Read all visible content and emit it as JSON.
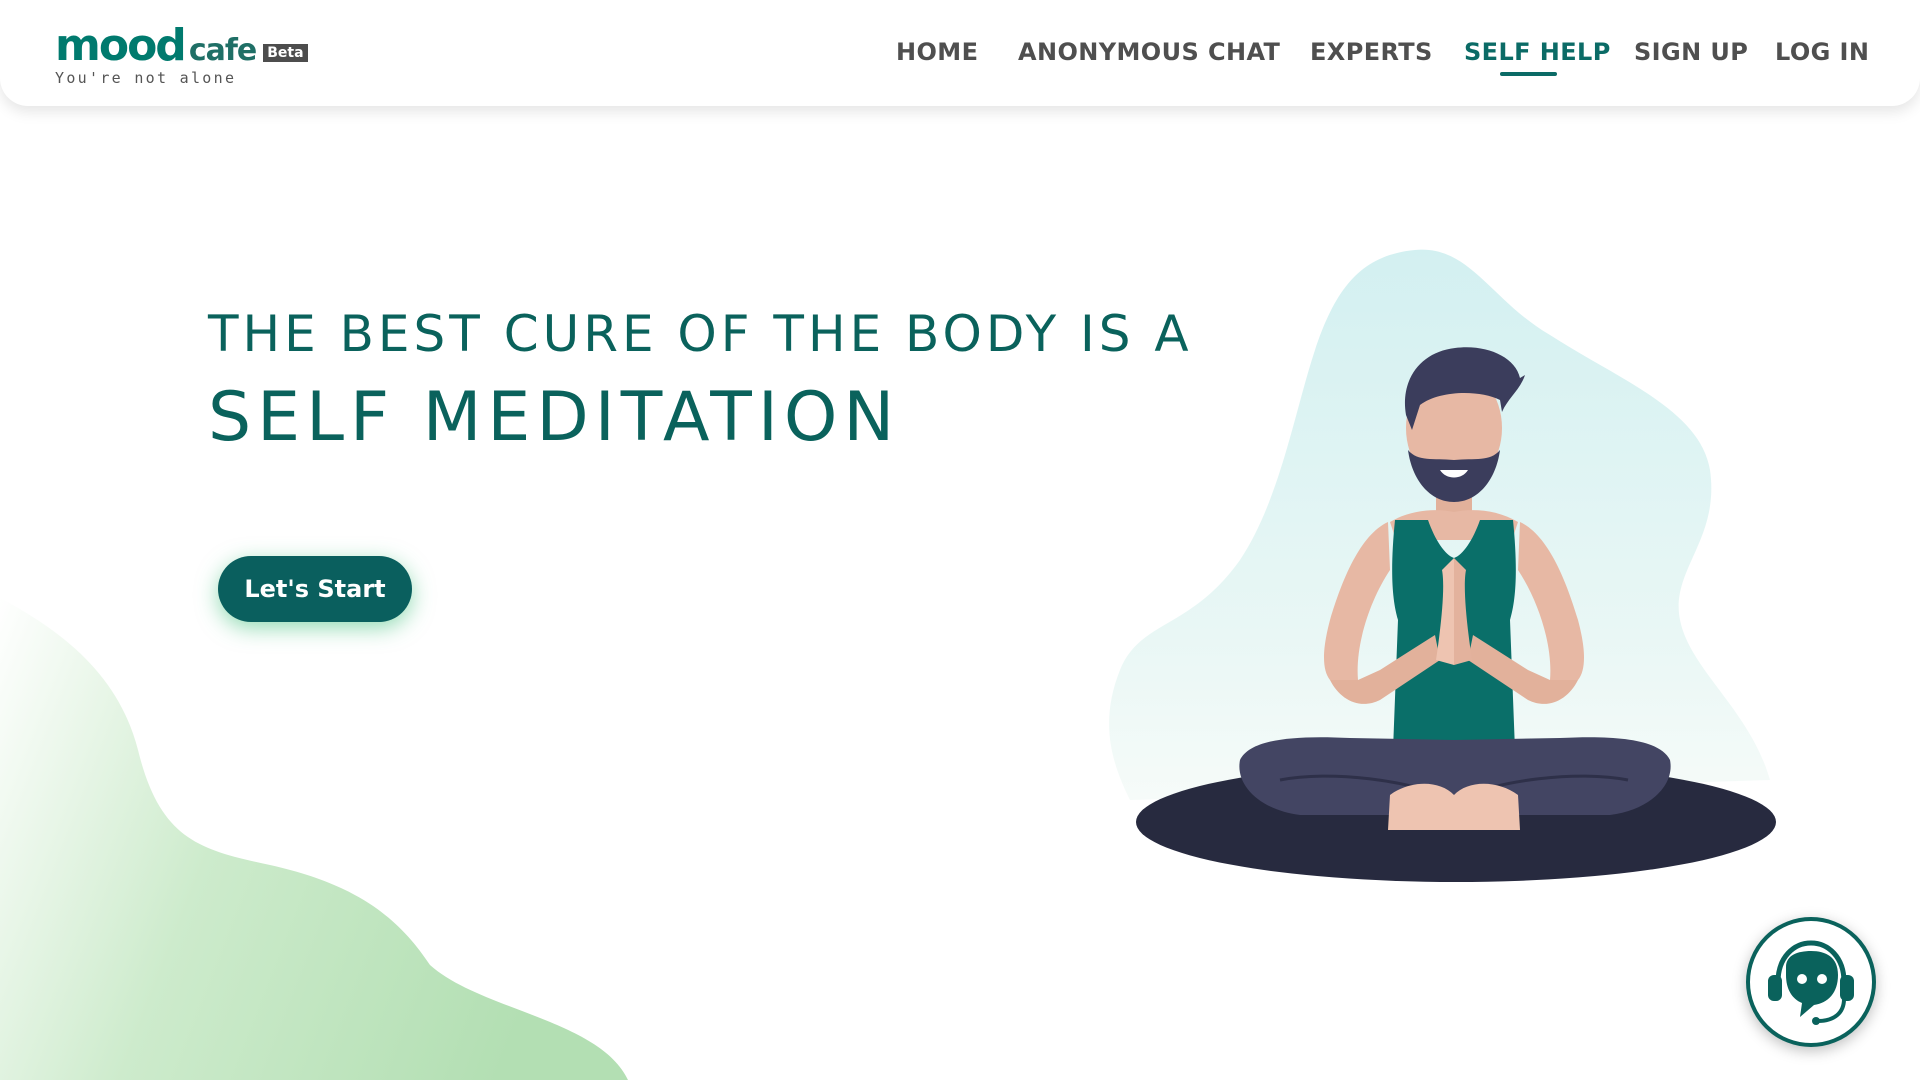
{
  "brand": {
    "logo_mood": "mood",
    "logo_cafe": "cafe",
    "logo_badge": "Beta",
    "tagline": "You're not alone"
  },
  "nav": {
    "items": [
      {
        "label": "HOME",
        "active": false
      },
      {
        "label": "ANONYMOUS CHAT",
        "active": false
      },
      {
        "label": "EXPERTS",
        "active": false
      },
      {
        "label": "SELF HELP",
        "active": true
      },
      {
        "label": "SIGN UP",
        "active": false
      },
      {
        "label": "LOG IN",
        "active": false
      }
    ]
  },
  "hero": {
    "line1": "THE BEST CURE OF THE BODY IS A",
    "line2": "SELF MEDITATION",
    "cta_label": "Let's Start"
  },
  "illustration": {
    "subject": "meditating-man-icon"
  },
  "support": {
    "icon": "chatbot-headset-icon"
  },
  "colors": {
    "primary": "#0a625c",
    "nav_text": "#4f4f4f",
    "cta_bg": "#0a5f5e",
    "blob_green": "#b8e2b8",
    "blob_cyan": "#d4f1f2"
  }
}
